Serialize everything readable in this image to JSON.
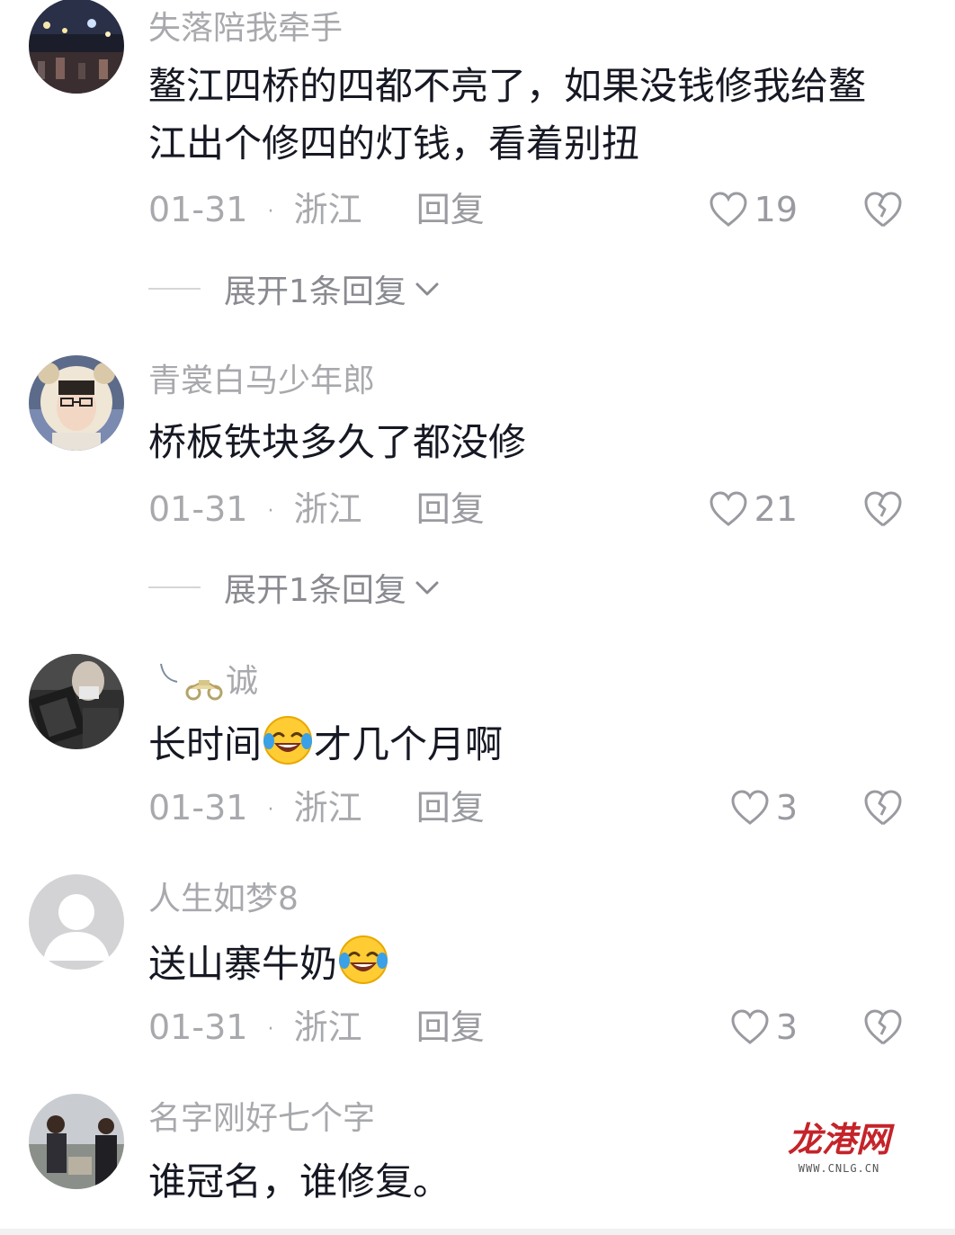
{
  "comments": [
    {
      "username": "失落陪我牵手",
      "content": "鳌江四桥的四都不亮了，如果没钱修我给鳌江出个修四的灯钱，看着别扭",
      "date": "01-31",
      "dot": "·",
      "location": "浙江",
      "reply_label": "回复",
      "likes": "19",
      "expand_label": "展开1条回复"
    },
    {
      "username": "青裳白马少年郎",
      "content": "桥板铁块多久了都没修",
      "date": "01-31",
      "dot": "·",
      "location": "浙江",
      "reply_label": "回复",
      "likes": "21",
      "expand_label": "展开1条回复"
    },
    {
      "username": "诚",
      "content_before": "长时间",
      "content_after": "才几个月啊",
      "emoji": "laugh-cry-emoji",
      "date": "01-31",
      "dot": "·",
      "location": "浙江",
      "reply_label": "回复",
      "likes": "3"
    },
    {
      "username": "人生如梦8",
      "content_before": "送山寨牛奶",
      "emoji": "laugh-cry-emoji",
      "date": "01-31",
      "dot": "·",
      "location": "浙江",
      "reply_label": "回复",
      "likes": "3"
    },
    {
      "username": "名字刚好七个字",
      "content": "谁冠名，谁修复。"
    }
  ],
  "watermark": {
    "logo_text": "龙港网",
    "url": "WWW.CNLG.CN"
  },
  "colors": {
    "username": "#a8a9ad",
    "text": "#161823",
    "meta": "#a8a9ad",
    "watermark": "#c4242a"
  }
}
